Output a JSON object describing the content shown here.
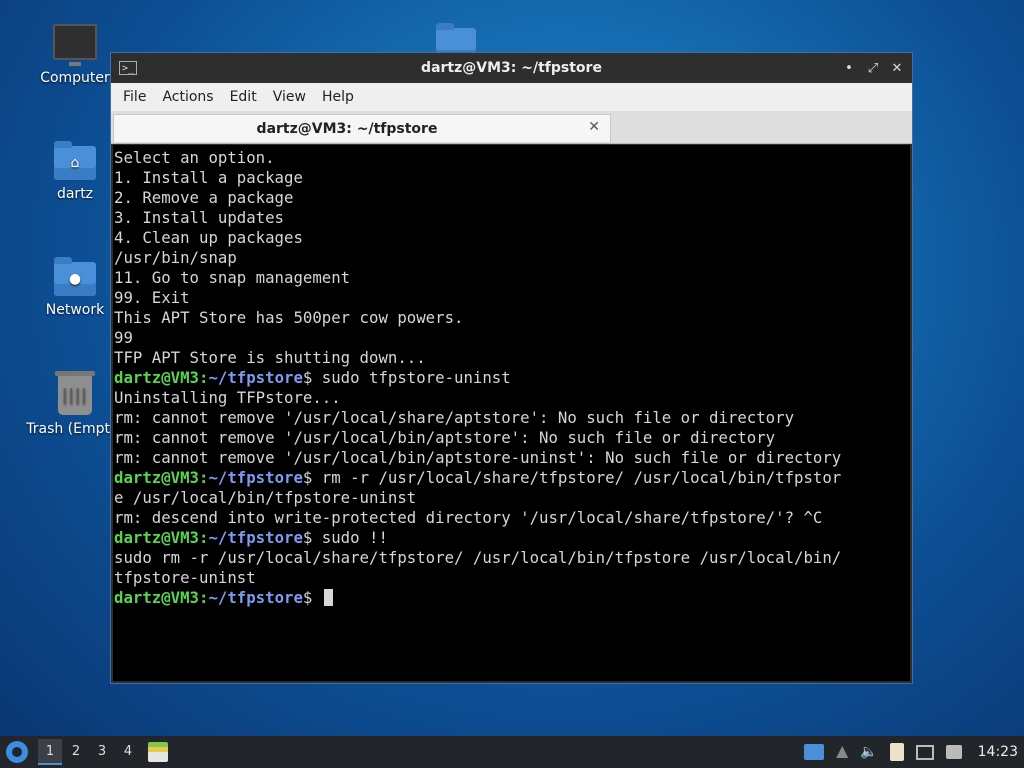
{
  "desktop": {
    "icons": [
      {
        "label": "Computer",
        "icon": "computer-icon"
      },
      {
        "label": "dartz",
        "icon": "home-folder-icon"
      },
      {
        "label": "Network",
        "icon": "network-folder-icon"
      },
      {
        "label": "Trash (Empty)",
        "icon": "trash-icon"
      }
    ]
  },
  "window": {
    "title": "dartz@VM3: ~/tfpstore",
    "app_icon": ">_",
    "controls": {
      "minimize": "•",
      "maximize": "⤢",
      "close": "✕"
    },
    "menu": [
      "File",
      "Actions",
      "Edit",
      "View",
      "Help"
    ],
    "tab": {
      "label": "dartz@VM3: ~/tfpstore",
      "close": "✕"
    }
  },
  "terminal": {
    "prompt_user": "dartz@VM3",
    "prompt_path": "~/tfpstore",
    "lines": [
      "Select an option.",
      "1. Install a package",
      "2. Remove a package",
      "3. Install updates",
      "4. Clean up packages",
      "/usr/bin/snap",
      "11. Go to snap management",
      "99. Exit",
      "This APT Store has 500per cow powers.",
      "99",
      "TFP APT Store is shutting down...",
      {
        "prompt": true,
        "cmd": "$ sudo tfpstore-uninst"
      },
      "Uninstalling TFPstore...",
      "rm: cannot remove '/usr/local/share/aptstore': No such file or directory",
      "rm: cannot remove '/usr/local/bin/aptstore': No such file or directory",
      "rm: cannot remove '/usr/local/bin/aptstore-uninst': No such file or directory",
      {
        "prompt": true,
        "cmd": "$ rm -r /usr/local/share/tfpstore/ /usr/local/bin/tfpstor"
      },
      "e /usr/local/bin/tfpstore-uninst",
      "rm: descend into write-protected directory '/usr/local/share/tfpstore/'? ^C",
      {
        "prompt": true,
        "cmd": "$ sudo !!"
      },
      "sudo rm -r /usr/local/share/tfpstore/ /usr/local/bin/tfpstore /usr/local/bin/",
      "tfpstore-uninst",
      {
        "prompt": true,
        "cmd": "$ ",
        "cursor": true
      }
    ]
  },
  "taskbar": {
    "workspaces": [
      "1",
      "2",
      "3",
      "4"
    ],
    "active_workspace": "1",
    "clock": "14:23"
  }
}
